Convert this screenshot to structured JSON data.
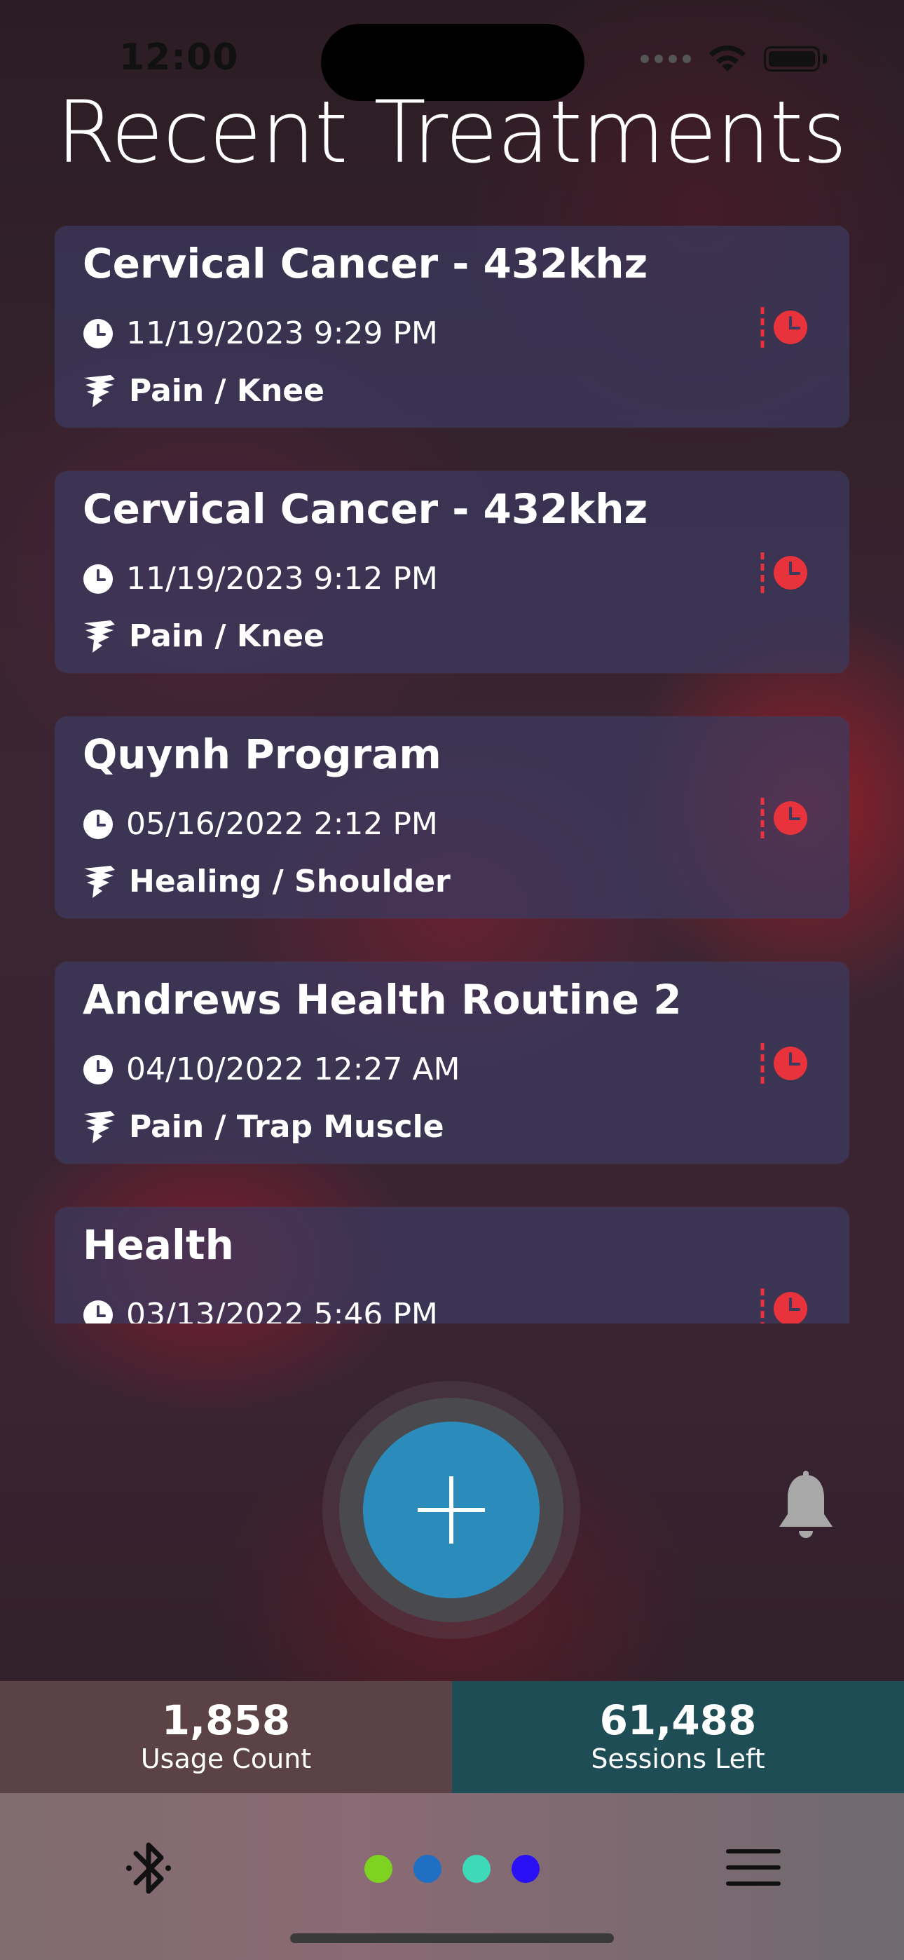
{
  "status_bar": {
    "time": "12:00"
  },
  "header": {
    "title": "Recent Treatments"
  },
  "treatments": [
    {
      "title": "Cervical Cancer - 432khz",
      "date": "11/19/2023 9:29 PM",
      "category": "Pain / Knee"
    },
    {
      "title": "Cervical Cancer - 432khz",
      "date": "11/19/2023 9:12 PM",
      "category": "Pain / Knee"
    },
    {
      "title": "Quynh Program",
      "date": "05/16/2022 2:12 PM",
      "category": "Healing / Shoulder"
    },
    {
      "title": "Andrews Health Routine 2",
      "date": "04/10/2022 12:27 AM",
      "category": "Pain / Trap Muscle"
    },
    {
      "title": "Health",
      "date": "03/13/2022 5:46 PM",
      "category": ""
    }
  ],
  "stats": {
    "usage_count": {
      "value": "1,858",
      "label": "Usage Count"
    },
    "sessions_left": {
      "value": "61,488",
      "label": "Sessions Left"
    }
  },
  "icons": {
    "add": "plus-icon",
    "notifications": "bell-icon",
    "bluetooth": "bluetooth-icon",
    "menu": "hamburger-menu-icon",
    "history": "clock-history-icon"
  },
  "colors": {
    "accent_history": "#e8323c",
    "add_button": "#2b8bba",
    "dot_1": "#7ed321",
    "dot_2": "#1f6fc4",
    "dot_3": "#3dd9b8",
    "dot_4": "#2a10f5",
    "usage_bg": "#5a4246",
    "sessions_bg": "#1f4d55"
  }
}
